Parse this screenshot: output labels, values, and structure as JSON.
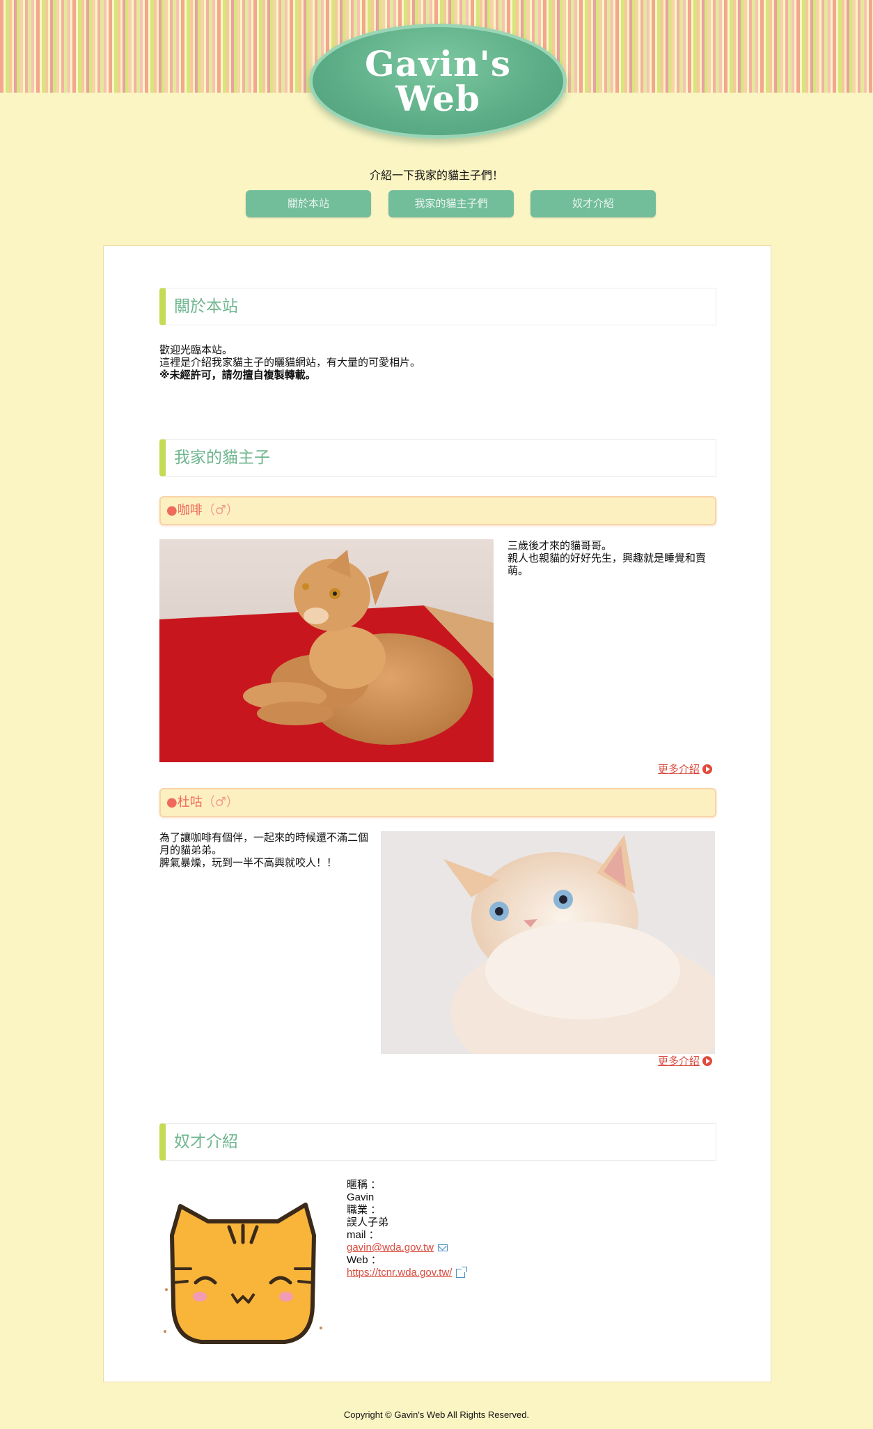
{
  "header": {
    "logo_text": "Gavin's\nWeb",
    "tagline": "介紹一下我家的貓主子們！"
  },
  "nav": {
    "items": [
      "關於本站",
      "我家的貓主子們",
      "奴才介紹"
    ]
  },
  "about": {
    "title": "關於本站",
    "line1": "歡迎光臨本站。",
    "line2": "這裡是介紹我家貓主子的曬貓網站，有大量的可愛相片。",
    "line3": "※未經許可，請勿擅自複製轉載。"
  },
  "cats": {
    "title": "我家的貓主子",
    "items": [
      {
        "name": "●咖啡",
        "sex": "（♂）",
        "desc1": "三歲後才來的貓哥哥。",
        "desc2": "親人也親貓的好好先生，興趣就是睡覺和賣萌。",
        "more": "更多介紹"
      },
      {
        "name": "●杜咕",
        "sex": "（♂）",
        "desc1": "為了讓咖啡有個伴，一起來的時候還不滿二個月的貓弟弟。",
        "desc2": "脾氣暴燥，玩到一半不高興就咬人！！",
        "more": "更多介紹"
      }
    ]
  },
  "servant": {
    "title": "奴才介紹",
    "nick_label": "暱稱 ：",
    "nick": "Gavin",
    "job_label": "職業 ：",
    "job": "誤人子弟",
    "mail_label": "mail ：",
    "mail": "gavin@wda.gov.tw",
    "web_label": "Web ：",
    "web": "https://tcnr.wda.gov.tw/"
  },
  "footer": {
    "copyright": "Copyright © Gavin's Web All Rights Reserved."
  },
  "colors": {
    "background": "#fbf5c4",
    "accent_green": "#72bd9a",
    "title_bar": "#c3db55",
    "link_red": "#d94b3e"
  },
  "icons": [
    "play-arrow-icon",
    "mail-icon",
    "external-link-icon"
  ]
}
